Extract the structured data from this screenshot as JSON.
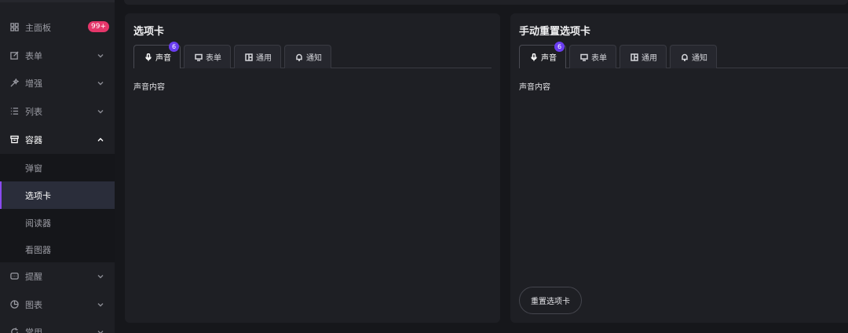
{
  "sidebar": {
    "items_top": [
      {
        "label": "主面板",
        "icon": "dashboard-grid-icon",
        "badge": "99+"
      },
      {
        "label": "表单",
        "icon": "form-edit-icon"
      },
      {
        "label": "增强",
        "icon": "magic-wand-icon"
      },
      {
        "label": "列表",
        "icon": "list-icon"
      },
      {
        "label": "容器",
        "icon": "archive-box-icon"
      }
    ],
    "sub_items": [
      {
        "label": "弹窗"
      },
      {
        "label": "选项卡"
      },
      {
        "label": "阅读器"
      },
      {
        "label": "看图器"
      }
    ],
    "items_bottom": [
      {
        "label": "提醒",
        "icon": "message-icon"
      },
      {
        "label": "图表",
        "icon": "pie-chart-icon"
      },
      {
        "label": "常用",
        "icon": "refresh-icon"
      }
    ]
  },
  "card1": {
    "title": "选项卡",
    "tabs": [
      {
        "label": "声音",
        "icon": "microphone-icon",
        "badge": "6"
      },
      {
        "label": "表单",
        "icon": "monitor-icon"
      },
      {
        "label": "通用",
        "icon": "layout-icon"
      },
      {
        "label": "通知",
        "icon": "bell-icon"
      }
    ],
    "content": "声音内容"
  },
  "card2": {
    "title": "手动重置选项卡",
    "tabs": [
      {
        "label": "声音",
        "icon": "microphone-icon",
        "badge": "6"
      },
      {
        "label": "表单",
        "icon": "monitor-icon"
      },
      {
        "label": "通用",
        "icon": "layout-icon"
      },
      {
        "label": "通知",
        "icon": "bell-icon"
      }
    ],
    "content": "声音内容",
    "reset_label": "重置选项卡"
  },
  "colors": {
    "accent": "#8a4af0",
    "badge_red": "#e5366a",
    "tab_badge": "#6a3df0"
  }
}
